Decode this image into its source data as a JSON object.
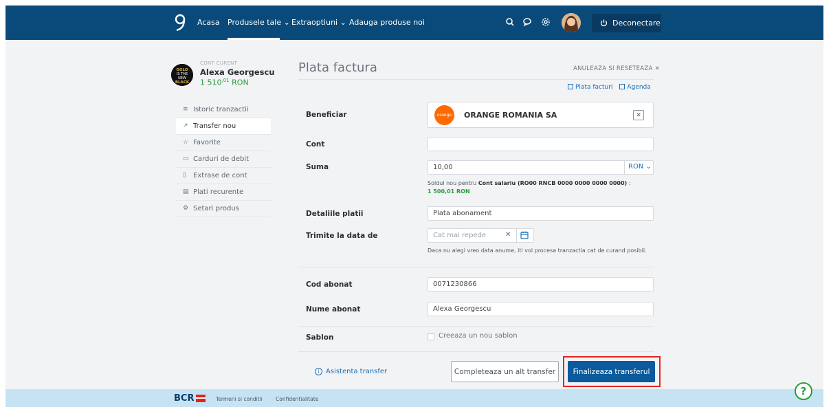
{
  "nav": {
    "items": [
      {
        "label": "Acasa"
      },
      {
        "label": "Produsele tale"
      },
      {
        "label": "Extraoptiuni"
      },
      {
        "label": "Adauga produse noi"
      }
    ],
    "logout_label": "Deconectare"
  },
  "account": {
    "label": "CONT CURENT",
    "name": "Alexa Georgescu",
    "balance_main": "1 510",
    "balance_decimals": ",01",
    "currency": "RON",
    "avatar_text": "GOLD IS THE NEW BLACK"
  },
  "sidebar": {
    "items": [
      {
        "label": "Istoric tranzactii",
        "icon": "list-icon"
      },
      {
        "label": "Transfer nou",
        "icon": "arrow-up-right-icon"
      },
      {
        "label": "Favorite",
        "icon": "star-icon"
      },
      {
        "label": "Carduri de debit",
        "icon": "card-icon"
      },
      {
        "label": "Extrase de cont",
        "icon": "document-icon"
      },
      {
        "label": "Plati recurente",
        "icon": "clipboard-icon"
      },
      {
        "label": "Setari produs",
        "icon": "gear-icon"
      }
    ]
  },
  "form": {
    "title": "Plata factura",
    "cancel_label": "ANULEAZA SI RESETEAZA",
    "link_bills": "Plata facturi",
    "link_agenda": "Agenda",
    "beneficiary_label": "Beneficiar",
    "beneficiary_name": "ORANGE ROMANIA SA",
    "beneficiary_logo_text": "orange",
    "account_label": "Cont",
    "account_value": "",
    "amount_label": "Suma",
    "amount_value": "10,00",
    "amount_currency": "RON",
    "balance_hint_prefix": "Soldul nou pentru",
    "balance_hint_account": "Cont salariu (RO00 RNCB 0000 0000 0000 0000)",
    "balance_hint_suffix": ":",
    "balance_hint_value": "1 500,01 RON",
    "details_label": "Detaliile platii",
    "details_value": "Plata abonament",
    "date_label": "Trimite la data de",
    "date_placeholder": "Cat mai repede",
    "date_hint": "Daca nu alegi vreo data anume, iti voi procesa tranzactia cat de curand posibil.",
    "subscriber_code_label": "Cod abonat",
    "subscriber_code_value": "0071230866",
    "subscriber_name_label": "Nume abonat",
    "subscriber_name_value": "Alexa Georgescu",
    "template_label": "Sablon",
    "template_checkbox_label": "Creeaza un nou sablon",
    "help_label": "Asistenta transfer",
    "secondary_button": "Completeaza un alt transfer",
    "primary_button": "Finalizeaza transferul"
  },
  "footer": {
    "brand": "BCR",
    "terms": "Termeni si conditii",
    "privacy": "Confidentialitate"
  },
  "colors": {
    "nav_bg": "#0a4a7a",
    "primary": "#0a5a9c",
    "accent_green": "#2a9d3a",
    "highlight_red": "#e02525",
    "footer_bg": "#c6e3f4"
  }
}
